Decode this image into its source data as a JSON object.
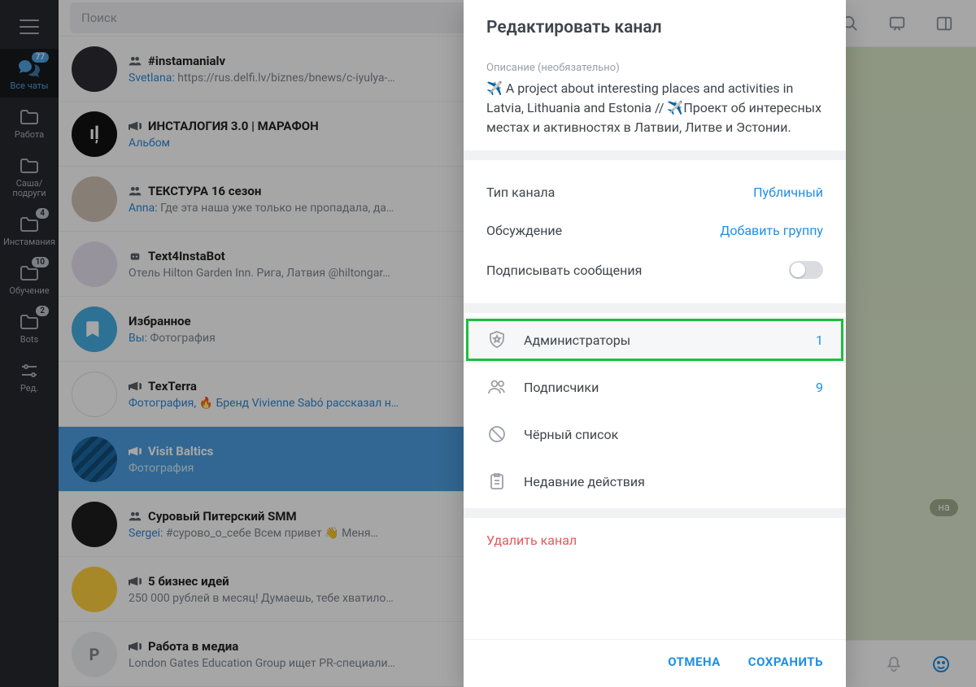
{
  "search": {
    "placeholder": "Поиск"
  },
  "rail": [
    {
      "label": "Все чаты",
      "badge": "77"
    },
    {
      "label": "Работа",
      "badge": ""
    },
    {
      "label": "Саша/\nподруги",
      "badge": ""
    },
    {
      "label": "Инстамания",
      "badge": "4"
    },
    {
      "label": "Обучение",
      "badge": "10"
    },
    {
      "label": "Bots",
      "badge": "2"
    },
    {
      "label": "Ред.",
      "badge": ""
    }
  ],
  "chats": [
    {
      "title": "#instamanialv",
      "icon": "group",
      "sender": "Svetlana:",
      "msg": "https://rus.delfi.lv/biznes/bnews/c-iyulya-…"
    },
    {
      "title": "ИНСТАЛОГИЯ 3.0 | МАРАФОН",
      "icon": "channel",
      "sender": "",
      "msg": "Альбом",
      "senderIsLink": true
    },
    {
      "title": "ТЕКСТУРА 16 сезон",
      "icon": "group",
      "sender": "Anna:",
      "msg": "Где эта наша уже только не пропадала, да…"
    },
    {
      "title": "Text4InstaBot",
      "icon": "bot",
      "sender": "",
      "msg": "Отель Hilton Garden Inn. Рига, Латвия @hiltongar…"
    },
    {
      "title": "Избранное",
      "icon": "",
      "sender": "Вы:",
      "msg": "Фотография"
    },
    {
      "title": "TexTerra",
      "icon": "channel",
      "sender": "",
      "msg": "Фотография, 🔥 Бренд Vivienne Sabó рассказал н…",
      "senderIsLink": true
    },
    {
      "title": "Visit Baltics",
      "icon": "channel",
      "sender": "",
      "msg": "Фотография",
      "active": true
    },
    {
      "title": "Суровый Питерский SMM",
      "icon": "group",
      "sender": "Sergei:",
      "msg": "#сурово_о_себе  Всем привет 👋  Меня…"
    },
    {
      "title": "5 бизнес идей",
      "icon": "channel",
      "sender": "",
      "msg": "250 000 рублей в месяц!  Думаешь, тебе хватило…"
    },
    {
      "title": "Работа в медиа",
      "icon": "channel",
      "sender": "",
      "msg": "London Gates Education Group ищет PR-специали…"
    }
  ],
  "modal": {
    "title": "Редактировать канал",
    "descLabel": "Описание (необязательно)",
    "description": "✈️  A project about interesting places and activities in Latvia, Lithuania and Estonia // ✈️Проект об интересных местах и активностях в Латвии, Литве и Эстонии.",
    "settings": {
      "typeLabel": "Тип канала",
      "typeValue": "Публичный",
      "discussionLabel": "Обсуждение",
      "discussionValue": "Добавить группу",
      "signLabel": "Подписывать сообщения"
    },
    "mgmt": [
      {
        "label": "Администраторы",
        "count": "1",
        "highlight": true
      },
      {
        "label": "Подписчики",
        "count": "9"
      },
      {
        "label": "Чёрный список",
        "count": ""
      },
      {
        "label": "Недавние действия",
        "count": ""
      }
    ],
    "delete": "Удалить канал",
    "cancel": "ОТМЕНА",
    "save": "СОХРАНИТЬ"
  },
  "rpTag": "на"
}
